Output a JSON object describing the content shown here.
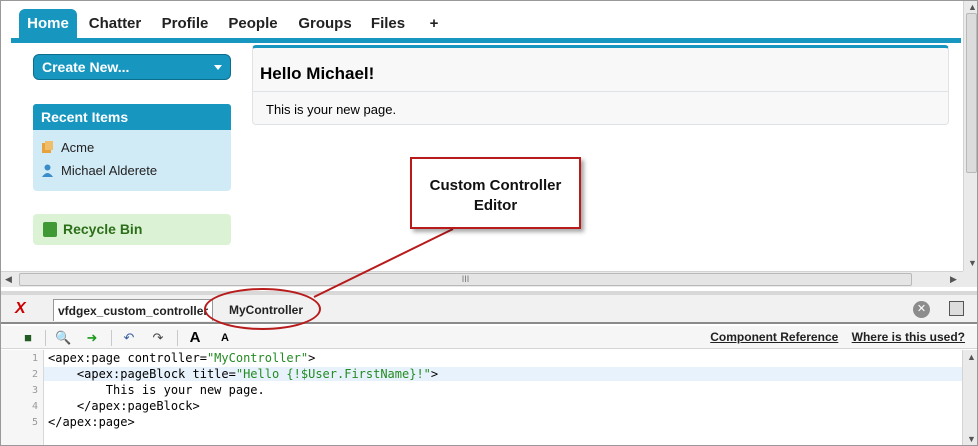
{
  "nav": {
    "tabs": [
      "Home",
      "Chatter",
      "Profile",
      "People",
      "Groups",
      "Files",
      "+"
    ],
    "active": "Home"
  },
  "sidebar": {
    "create_new": "Create New...",
    "recent_items_title": "Recent Items",
    "recent_items": [
      {
        "label": "Acme",
        "icon": "account-icon"
      },
      {
        "label": "Michael Alderete",
        "icon": "user-icon"
      }
    ],
    "recycle_bin": "Recycle Bin"
  },
  "page_block": {
    "title": "Hello Michael!",
    "body": "This is your new page."
  },
  "dev_footer": {
    "tabs": [
      "vfdgex_custom_controller",
      "MyController"
    ],
    "selected": "vfdgex_custom_controller",
    "links": [
      "Component Reference",
      "Where is this used?"
    ],
    "font_buttons": [
      "A",
      "A"
    ]
  },
  "code": {
    "line_numbers": [
      "1",
      "2",
      "3",
      "4",
      "5"
    ],
    "lines": [
      {
        "a": "<apex:page controller=",
        "s": "\"MyController\"",
        "b": ">"
      },
      {
        "a": "    <apex:pageBlock title=",
        "s": "\"Hello {!$User.FirstName}!\"",
        "b": ">"
      },
      {
        "a": "        This is your new page.",
        "s": "",
        "b": ""
      },
      {
        "a": "    </apex:pageBlock>",
        "s": "",
        "b": ""
      },
      {
        "a": "</apex:page>",
        "s": "",
        "b": ""
      }
    ],
    "highlighted_line": 2
  },
  "callout": {
    "text_line1": "Custom Controller",
    "text_line2": "Editor"
  },
  "scrollbar": {
    "grip": "III"
  },
  "colors": {
    "accent": "#1797c0",
    "callout": "#b81b1b",
    "recent_bg": "#d0eaf6",
    "recycle_bg": "#dbf3d4"
  }
}
